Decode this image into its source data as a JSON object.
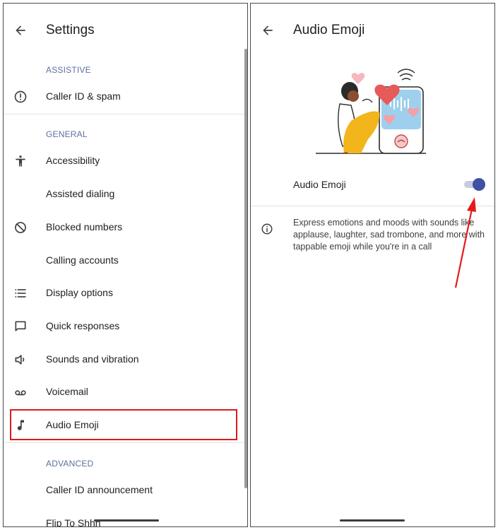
{
  "left": {
    "title": "Settings",
    "sections": {
      "assistive": "ASSISTIVE",
      "general": "GENERAL",
      "advanced": "ADVANCED"
    },
    "items": {
      "caller_id_spam": "Caller ID & spam",
      "accessibility": "Accessibility",
      "assisted_dialing": "Assisted dialing",
      "blocked_numbers": "Blocked numbers",
      "calling_accounts": "Calling accounts",
      "display_options": "Display options",
      "quick_responses": "Quick responses",
      "sounds_vibration": "Sounds and vibration",
      "voicemail": "Voicemail",
      "audio_emoji": "Audio Emoji",
      "caller_id_announcement": "Caller ID announcement",
      "flip_to_shhh": "Flip To Shhh"
    },
    "highlight_color": "#d81c1c"
  },
  "right": {
    "title": "Audio Emoji",
    "toggle_label": "Audio Emoji",
    "toggle_on": true,
    "description": "Express emotions and moods with sounds like applause, laughter, sad trombone, and more with tappable emoji while you're in a call",
    "accent_color": "#3f51a3",
    "arrow_color": "#e31b1b"
  },
  "icons": {
    "back": "arrow-left-icon",
    "caller_id_spam": "alert-circle-icon",
    "accessibility": "accessibility-person-icon",
    "blocked_numbers": "block-icon",
    "display_options": "list-icon",
    "quick_responses": "message-square-icon",
    "sounds_vibration": "speaker-icon",
    "voicemail": "voicemail-icon",
    "audio_emoji": "music-note-icon",
    "info": "info-icon"
  }
}
